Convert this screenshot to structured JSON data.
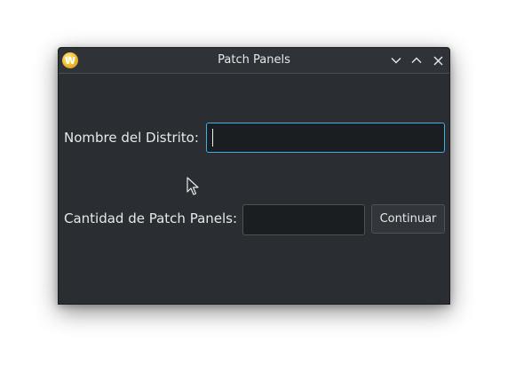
{
  "window": {
    "title": "Patch Panels",
    "app_icon": "app-logo-icon",
    "app_icon_letter": "W",
    "controls": [
      "minimize-icon",
      "maximize-icon",
      "close-icon"
    ]
  },
  "form": {
    "district_label": "Nombre del Distrito:",
    "district_value": "",
    "quantity_label": "Cantidad de Patch Panels:",
    "quantity_value": "",
    "continue_label": "Continuar"
  },
  "colors": {
    "window_bg": "#2a2e32",
    "focus_border": "#3daee9",
    "text": "#e6e8ea"
  }
}
